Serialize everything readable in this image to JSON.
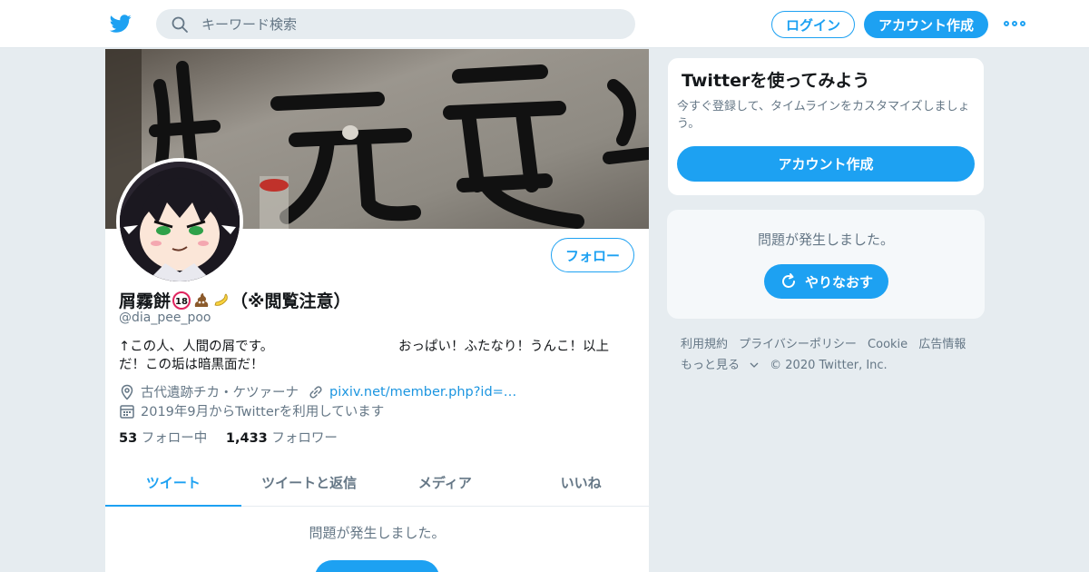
{
  "header": {
    "search_placeholder": "キーワード検索",
    "login_label": "ログイン",
    "signup_label": "アカウント作成"
  },
  "profile": {
    "follow_label": "フォロー",
    "name": "屑霧餅",
    "name_suffix": "（※閲覧注意）",
    "handle": "@dia_pee_poo",
    "bio": "↑この人、人間の屑です。　　　　　　　　　　おっぱい！ふたなり！うんこ！以上だ！この垢は暗黒面だ！",
    "location": "古代遺跡チカ・ケツァーナ",
    "url": "pixiv.net/member.php?id=…",
    "joined": "2019年9月からTwitterを利用しています",
    "following_count": "53",
    "following_label": "フォロー中",
    "followers_count": "1,433",
    "followers_label": "フォロワー",
    "emoji_names": [
      "18-prohibited-icon",
      "poo-icon",
      "banana-icon"
    ]
  },
  "tabs": [
    {
      "label": "ツイート"
    },
    {
      "label": "ツイートと返信"
    },
    {
      "label": "メディア"
    },
    {
      "label": "いいね"
    }
  ],
  "timeline": {
    "error_message": "問題が発生しました。"
  },
  "sidebar": {
    "signup_card": {
      "title": "Twitterを使ってみよう",
      "description": "今すぐ登録して、タイムラインをカスタマイズしましょう。",
      "button_label": "アカウント作成"
    },
    "error_card": {
      "message": "問題が発生しました。",
      "retry_label": "やりなおす"
    },
    "footer_links": [
      "利用規約",
      "プライバシーポリシー",
      "Cookie",
      "広告情報",
      "もっと見る"
    ],
    "copyright": "© 2020 Twitter, Inc."
  },
  "colors": {
    "accent": "#1da1f2",
    "background": "#e6ecf0",
    "text_secondary": "#657786"
  }
}
